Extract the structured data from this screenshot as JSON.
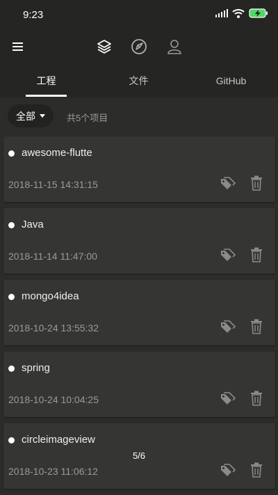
{
  "status_bar": {
    "time": "9:23"
  },
  "tabs": [
    {
      "label": "工程",
      "active": true
    },
    {
      "label": "文件",
      "active": false
    },
    {
      "label": "GitHub",
      "active": false
    }
  ],
  "filter": {
    "selected": "全部",
    "count_text": "共5个项目"
  },
  "projects": [
    {
      "name": "awesome-flutte",
      "date": "2018-11-15 14:31:15"
    },
    {
      "name": "Java",
      "date": "2018-11-14 11:47:00"
    },
    {
      "name": "mongo4idea",
      "date": "2018-10-24 13:55:32"
    },
    {
      "name": "spring",
      "date": "2018-10-24 10:04:25"
    },
    {
      "name": "circleimageview",
      "date": "2018-10-23 11:06:12"
    }
  ],
  "page_indicator": "5/6",
  "icons": {
    "menu": "menu-icon",
    "layers": "layers-icon",
    "navigate": "navigation-icon",
    "account": "person-icon",
    "tag": "tag-icon",
    "delete": "trash-icon"
  },
  "colors": {
    "background": "#2c2c2a",
    "toolbar": "#252523",
    "card": "#353533",
    "indicator": "#ffffff",
    "battery": "#4cd964"
  }
}
